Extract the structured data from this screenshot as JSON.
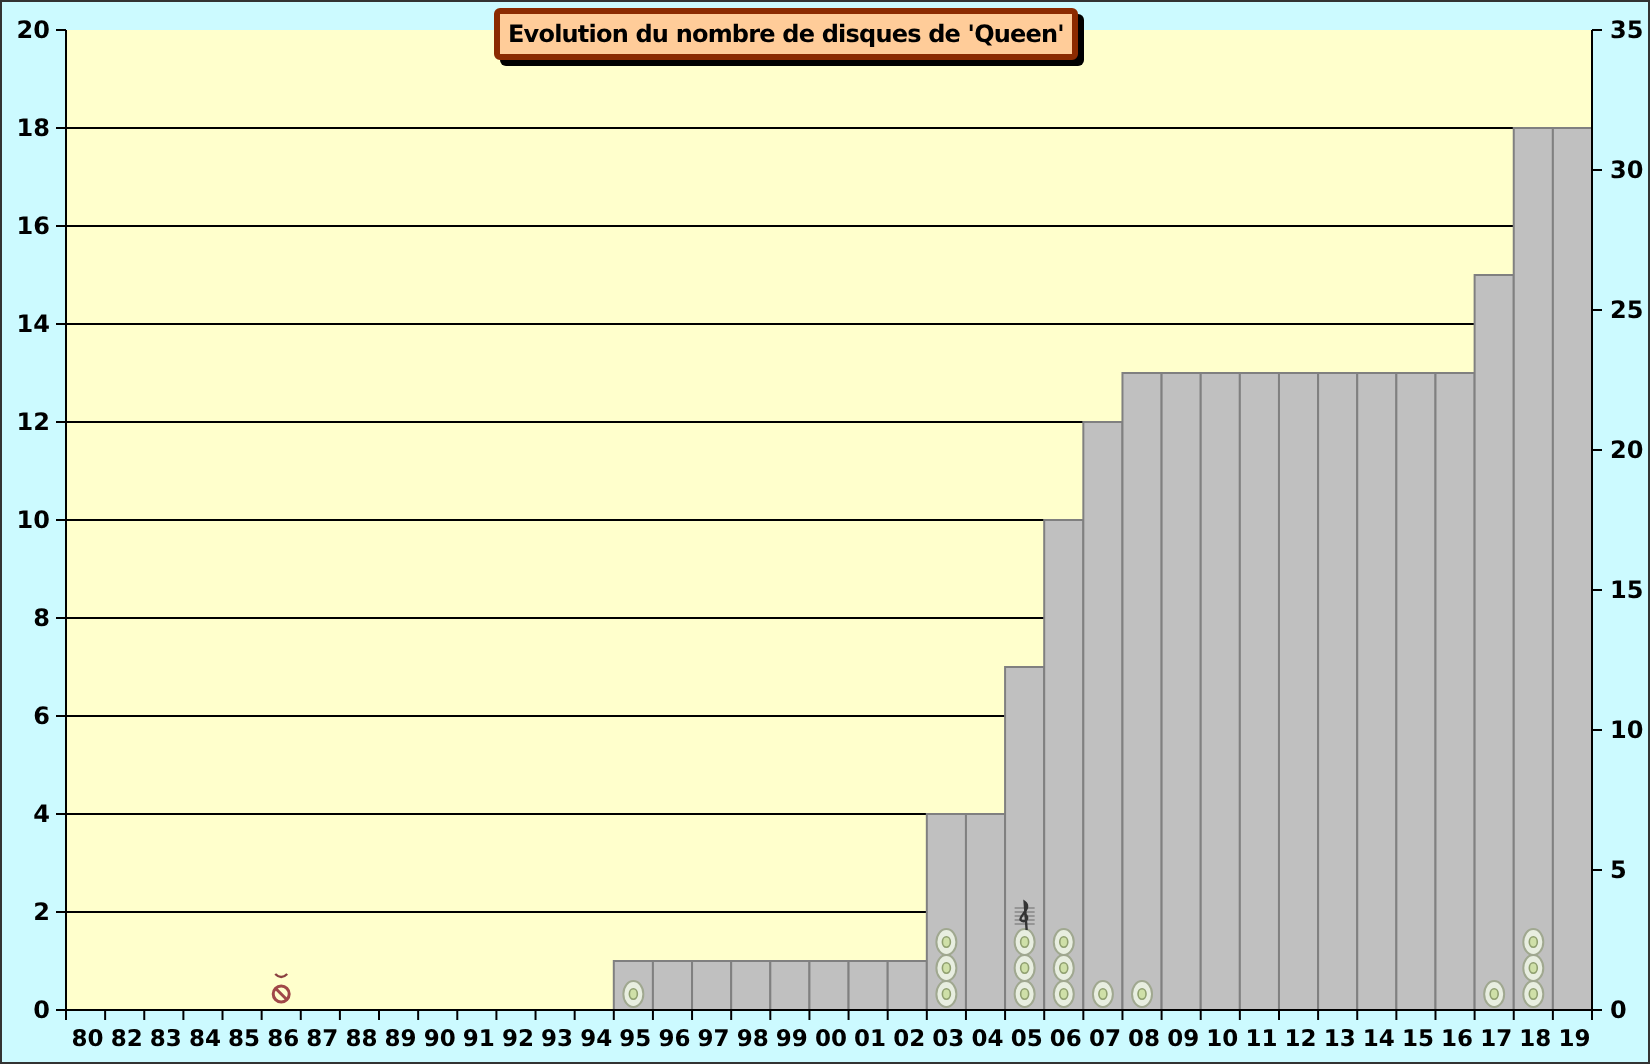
{
  "chart_data": {
    "type": "bar",
    "title": "Evolution du nombre de disques de 'Queen'",
    "categories": [
      "80",
      "82",
      "83",
      "84",
      "85",
      "86",
      "87",
      "88",
      "89",
      "90",
      "91",
      "92",
      "93",
      "94",
      "95",
      "96",
      "97",
      "98",
      "99",
      "00",
      "01",
      "02",
      "03",
      "04",
      "05",
      "06",
      "07",
      "08",
      "09",
      "10",
      "11",
      "12",
      "13",
      "14",
      "15",
      "16",
      "17",
      "18",
      "19"
    ],
    "series": [
      {
        "color": "#c0c0c0",
        "values": [
          0,
          0,
          0,
          0,
          0,
          0,
          0,
          0,
          0,
          0,
          0,
          0,
          0,
          0,
          1,
          1,
          1,
          1,
          1,
          1,
          1,
          1,
          4,
          4,
          7,
          10,
          12,
          13,
          13,
          13,
          13,
          13,
          13,
          13,
          13,
          13,
          15,
          18,
          18
        ]
      }
    ],
    "ylim": [
      0,
      20
    ],
    "yticks": [
      0,
      2,
      4,
      6,
      8,
      10,
      12,
      14,
      16,
      18,
      20
    ],
    "grid": true,
    "annotations": [
      {
        "x": "86"
      },
      {
        "x": "95"
      },
      {
        "x": "03"
      },
      {
        "x": "03"
      },
      {
        "x": "03"
      },
      {
        "x": "05"
      },
      {
        "x": "05"
      },
      {
        "x": "05"
      },
      {
        "x": "05"
      },
      {
        "x": "06"
      },
      {
        "x": "06"
      },
      {
        "x": "06"
      },
      {
        "x": "07"
      },
      {
        "x": "08"
      },
      {
        "x": "17"
      },
      {
        "x": "18"
      },
      {
        "x": "18"
      },
      {
        "x": "18"
      }
    ]
  },
  "right_axis": {
    "ticks": [
      "35",
      "30",
      "25",
      "20",
      "15",
      "10",
      "5",
      "0"
    ]
  },
  "markers": [
    {
      "kind": "prohibited"
    },
    {
      "kind": "disc"
    },
    {
      "kind": "disc"
    },
    {
      "kind": "disc"
    },
    {
      "kind": "disc"
    },
    {
      "kind": "disc"
    },
    {
      "kind": "disc"
    },
    {
      "kind": "disc"
    },
    {
      "kind": "clef"
    },
    {
      "kind": "disc"
    },
    {
      "kind": "disc"
    },
    {
      "kind": "disc"
    },
    {
      "kind": "disc"
    },
    {
      "kind": "disc"
    },
    {
      "kind": "disc"
    },
    {
      "kind": "disc"
    },
    {
      "kind": "disc"
    },
    {
      "kind": "disc"
    }
  ]
}
